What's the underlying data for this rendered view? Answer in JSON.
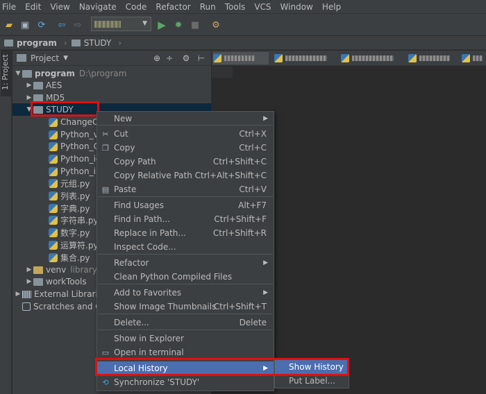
{
  "menubar": [
    "File",
    "Edit",
    "View",
    "Navigate",
    "Code",
    "Refactor",
    "Run",
    "Tools",
    "VCS",
    "Window",
    "Help"
  ],
  "breadcrumb": [
    "program",
    "STUDY"
  ],
  "left_stripe_tab": "1: Project",
  "project_panel": {
    "title": "Project",
    "tree": [
      {
        "label": "program",
        "path": "D:\\program",
        "level": 0,
        "type": "folder",
        "expanded": true,
        "bold": true
      },
      {
        "label": "AES",
        "level": 1,
        "type": "folder",
        "expanded": false
      },
      {
        "label": "MD5",
        "level": 1,
        "type": "folder",
        "expanded": false
      },
      {
        "label": "STUDY",
        "level": 1,
        "type": "folder",
        "expanded": true,
        "selected": true
      },
      {
        "label": "ChangeCo",
        "level": 2,
        "type": "py"
      },
      {
        "label": "Python_v",
        "level": 2,
        "type": "py"
      },
      {
        "label": "Python_Cl",
        "level": 2,
        "type": "py"
      },
      {
        "label": "Python_id",
        "level": 2,
        "type": "py"
      },
      {
        "label": "Python_in",
        "level": 2,
        "type": "py"
      },
      {
        "label": "元组.py",
        "level": 2,
        "type": "py"
      },
      {
        "label": "列表.py",
        "level": 2,
        "type": "py"
      },
      {
        "label": "字典.py",
        "level": 2,
        "type": "py"
      },
      {
        "label": "字符串.py",
        "level": 2,
        "type": "py"
      },
      {
        "label": "数字.py",
        "level": 2,
        "type": "py"
      },
      {
        "label": "运算符.py",
        "level": 2,
        "type": "py"
      },
      {
        "label": "集合.py",
        "level": 2,
        "type": "py"
      },
      {
        "label": "venv",
        "path": "library r",
        "level": 1,
        "type": "venv",
        "expanded": false
      },
      {
        "label": "workTools",
        "level": 1,
        "type": "folder",
        "expanded": false
      },
      {
        "label": "External Librarie",
        "level": 0,
        "type": "lib",
        "expanded": false
      },
      {
        "label": "Scratches and C",
        "level": 0,
        "type": "scratch"
      }
    ]
  },
  "context_menu": {
    "items": [
      {
        "label": "New",
        "shortcut": "",
        "submenu": true,
        "icon": ""
      },
      {
        "label": "Cut",
        "shortcut": "Ctrl+X",
        "icon": "scissors-icon"
      },
      {
        "label": "Copy",
        "shortcut": "Ctrl+C",
        "icon": "copy-icon"
      },
      {
        "label": "Copy Path",
        "shortcut": "Ctrl+Shift+C",
        "icon": ""
      },
      {
        "label": "Copy Relative Path",
        "shortcut": "Ctrl+Alt+Shift+C",
        "icon": ""
      },
      {
        "label": "Paste",
        "shortcut": "Ctrl+V",
        "icon": "paste-icon"
      },
      {
        "label": "Find Usages",
        "shortcut": "Alt+F7",
        "icon": ""
      },
      {
        "label": "Find in Path...",
        "shortcut": "Ctrl+Shift+F",
        "icon": ""
      },
      {
        "label": "Replace in Path...",
        "shortcut": "Ctrl+Shift+R",
        "icon": ""
      },
      {
        "label": "Inspect Code...",
        "shortcut": "",
        "icon": ""
      },
      {
        "label": "Refactor",
        "shortcut": "",
        "submenu": true,
        "icon": ""
      },
      {
        "label": "Clean Python Compiled Files",
        "shortcut": "",
        "icon": ""
      },
      {
        "label": "Add to Favorites",
        "shortcut": "",
        "submenu": true,
        "icon": ""
      },
      {
        "label": "Show Image Thumbnails",
        "shortcut": "Ctrl+Shift+T",
        "icon": ""
      },
      {
        "label": "Delete...",
        "shortcut": "Delete",
        "icon": ""
      },
      {
        "label": "Show in Explorer",
        "shortcut": "",
        "icon": ""
      },
      {
        "label": "Open in terminal",
        "shortcut": "",
        "icon": "terminal-icon"
      },
      {
        "label": "Local History",
        "shortcut": "",
        "submenu": true,
        "icon": "",
        "highlighted": true
      },
      {
        "label": "Synchronize 'STUDY'",
        "shortcut": "",
        "icon": "sync-icon"
      }
    ]
  },
  "submenu": {
    "items": [
      {
        "label": "Show History",
        "highlighted": true
      },
      {
        "label": "Put Label..."
      }
    ]
  },
  "colors": {
    "selection": "#4b6eaf",
    "highlight_box": "#e01010",
    "panel_bg": "#3c3f41",
    "editor_bg": "#2b2b2b"
  }
}
